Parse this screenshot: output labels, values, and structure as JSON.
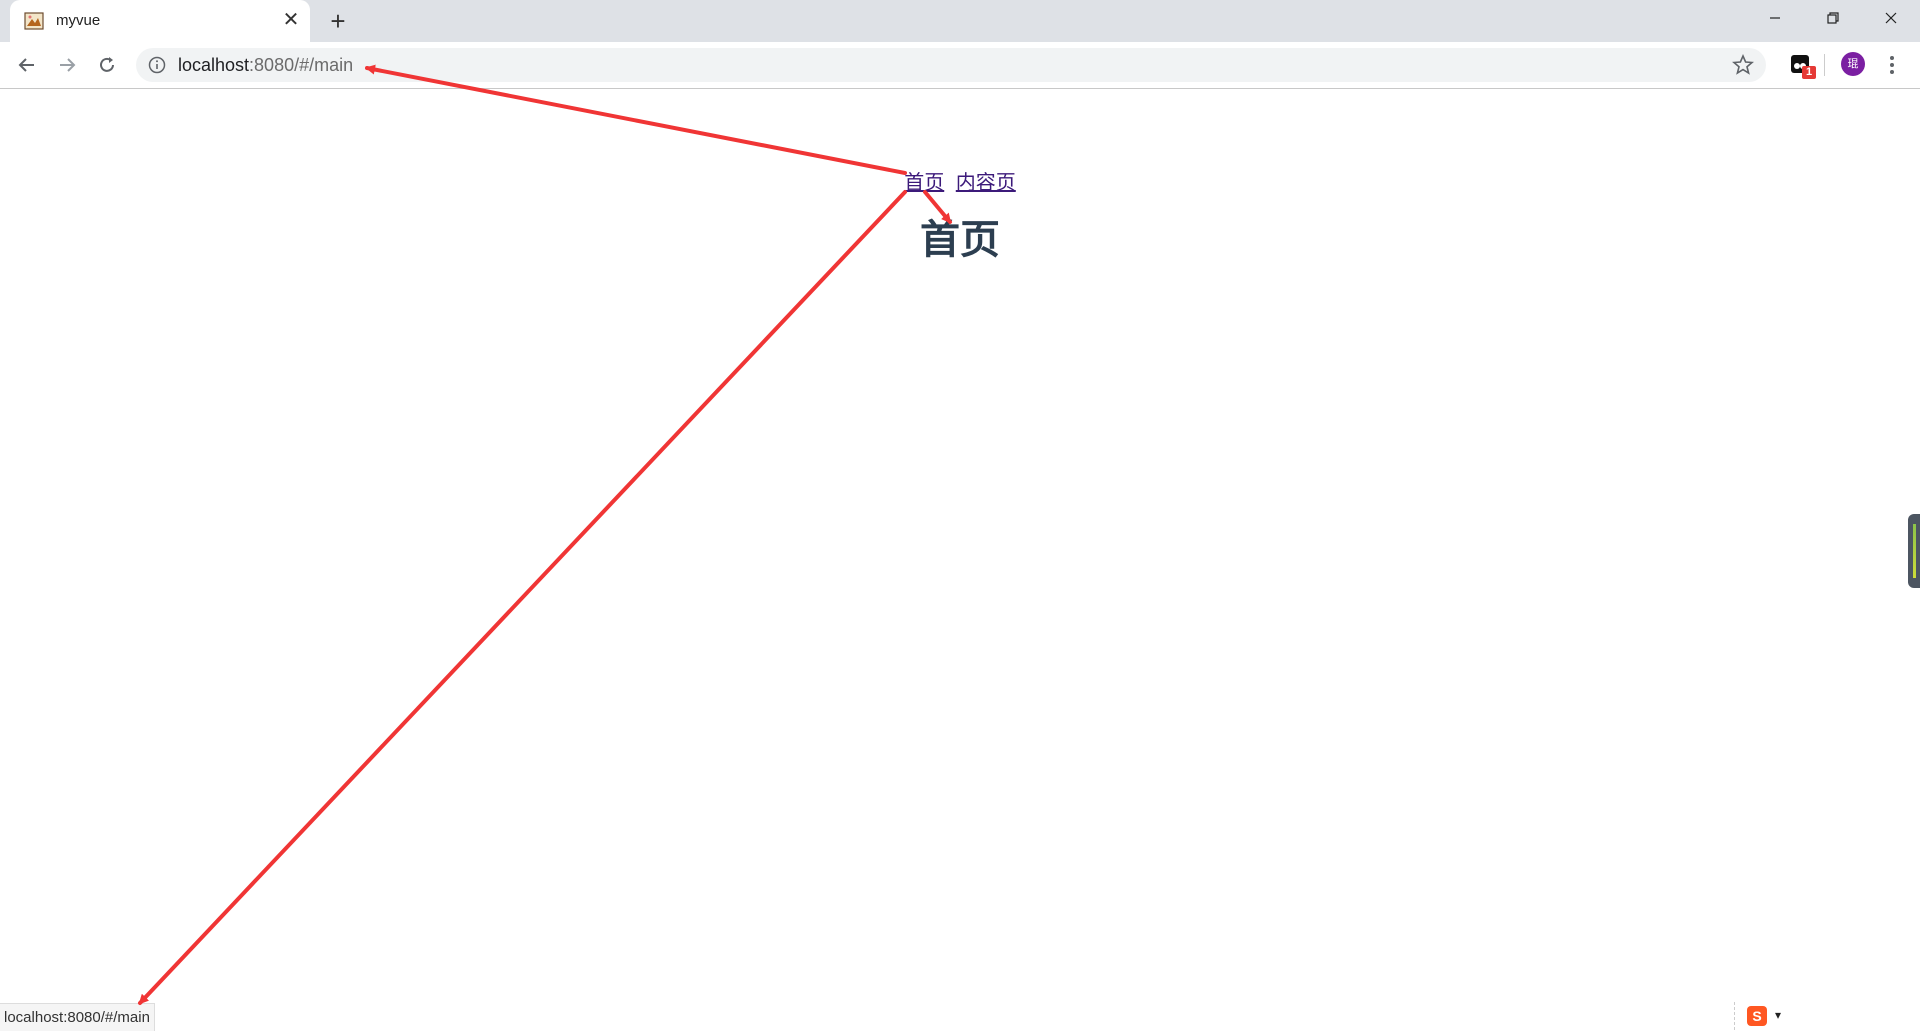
{
  "browser": {
    "tab_title": "myvue",
    "tab_close_glyph": "✕",
    "new_tab_glyph": "+",
    "url_host": "localhost",
    "url_rest": ":8080/#/main",
    "extension_badge": "1",
    "avatar_text": "琨"
  },
  "page": {
    "nav_links": [
      "首页",
      "内容页"
    ],
    "heading": "首页"
  },
  "status_bar": {
    "url": "localhost:8080/#/main"
  },
  "ime": {
    "logo": "S",
    "arrow": "▾"
  },
  "colors": {
    "annotation": "#f03535",
    "link": "#3c1a7a",
    "heading": "#2c3e50",
    "avatar": "#7b1fa2"
  }
}
